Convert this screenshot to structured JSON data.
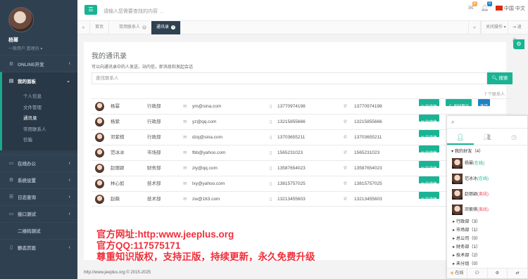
{
  "user": {
    "name": "杨幂",
    "role": "一般用户,管理员"
  },
  "sidebar": {
    "items": [
      {
        "label": "ONLINE开发",
        "icon": "gear-icon"
      },
      {
        "label": "我的面板",
        "icon": "book-icon"
      },
      {
        "label": "在线办公",
        "icon": "monitor-icon"
      },
      {
        "label": "系统设置",
        "icon": "gear-icon"
      },
      {
        "label": "日志查询",
        "icon": "list-icon"
      },
      {
        "label": "接口测试",
        "icon": "monitor-icon"
      },
      {
        "label": "二维码测试",
        "icon": "qr-icon"
      },
      {
        "label": "静态页面",
        "icon": "file-icon"
      }
    ],
    "sub_items": [
      "个人信息",
      "文件管理",
      "通讯录",
      "常用联系人",
      "信箱"
    ]
  },
  "topbar": {
    "search_placeholder": "请输入您需要查找的内容 …",
    "mail_badge": "0",
    "bell_badge": "0",
    "language": "中国 中文"
  },
  "tabs": {
    "items": [
      {
        "label": "首页"
      },
      {
        "label": "常用联系人"
      },
      {
        "label": "通讯录"
      }
    ],
    "close_ops": "关闭操作",
    "logout": "退出"
  },
  "contacts": {
    "title": "我的通讯录",
    "subtitle": "可以向通讯录中的人发送，站内信，即消息和发起会话",
    "search_placeholder": "查找联系人",
    "search_button": "搜索",
    "count_text": "7 个联系人",
    "btn_msg": "站内信",
    "btn_chat": "即时聊天",
    "btn_activate": "激活",
    "rows": [
      {
        "name": "杨幂",
        "dept": "行政部",
        "email": "ym@sina.com",
        "phone": "13770974198",
        "tel": "13770974198",
        "chat": true,
        "activate": true
      },
      {
        "name": "杨紫",
        "dept": "行政部",
        "email": "yz@qq.com",
        "phone": "13215855666",
        "tel": "13215855666",
        "chat": false,
        "activate": false
      },
      {
        "name": "邓紫棋",
        "dept": "行政部",
        "email": "dzq@sina.com",
        "phone": "13703655211",
        "tel": "13703655211",
        "chat": false,
        "activate": false
      },
      {
        "name": "范冰冰",
        "dept": "市场部",
        "email": "fbb@yahoo.com",
        "phone": "1565231023",
        "tel": "1565231023",
        "chat": false,
        "activate": false
      },
      {
        "name": "赵丽颖",
        "dept": "财务部",
        "email": "zly@qq.com",
        "phone": "13587654023",
        "tel": "13587654023",
        "chat": false,
        "activate": false
      },
      {
        "name": "林心如",
        "dept": "技术部",
        "email": "lxy@yahoo.com",
        "phone": "13815757025",
        "tel": "13815757025",
        "chat": false,
        "activate": false
      },
      {
        "name": "赵薇",
        "dept": "技术部",
        "email": "zw@163.com",
        "phone": "13213455603",
        "tel": "13213455603",
        "chat": false,
        "activate": false
      }
    ]
  },
  "watermark": [
    "官方网址:http:www.jeeplus.org",
    "官方QQ:117575171",
    "尊重知识版权，支持正版，持续更新，永久免费升级"
  ],
  "footer": "http://www.jeeplus.org © 2015-2025",
  "chat": {
    "my_friends": "我的好友（4）",
    "friends": [
      {
        "name": "杨幂",
        "status": "(在线)",
        "color": "#1ab394"
      },
      {
        "name": "范冰冰",
        "status": "(在线)",
        "color": "#1ab394"
      },
      {
        "name": "赵丽颖",
        "status": "(离线)",
        "color": "#ed5565"
      },
      {
        "name": "邓紫棋",
        "status": "(离线)",
        "color": "#ed5565"
      }
    ],
    "groups": [
      "行政部（3）",
      "市场部（1）",
      "总公司（0）",
      "财务部（1）",
      "技术部（2）",
      "未分组（0）"
    ],
    "status": "在线"
  },
  "colors": {
    "accent": "#1ab394",
    "sidebar": "#2f4050",
    "blue": "#1c84c6",
    "watermark": "#f0303c"
  }
}
